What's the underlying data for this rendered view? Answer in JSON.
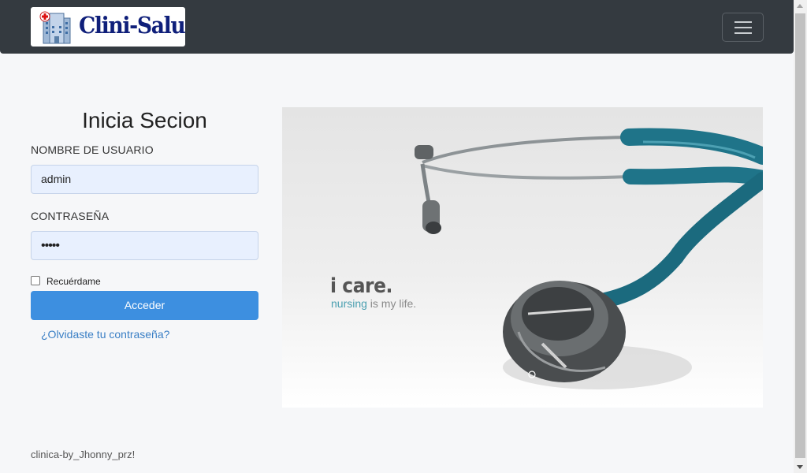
{
  "brand": {
    "name": "Clini-Salud",
    "logo_icon": "hospital-building-icon"
  },
  "navbar": {
    "toggler_icon": "hamburger-menu-icon"
  },
  "login": {
    "title": "Inicia Secion",
    "username_label": "NOMBRE DE USUARIO",
    "username_value": "admin",
    "password_label": "CONTRASEÑA",
    "password_value": "•••••",
    "remember_label": "Recuérdame",
    "submit_label": "Acceder",
    "forgot_link": "¿Olvidaste tu contraseña?"
  },
  "hero": {
    "headline": "i care.",
    "tagline_word": "nursing",
    "tagline_rest": " is my life.",
    "image_subject": "stethoscope-image"
  },
  "footer": {
    "text": "clinica-by_Jhonny_prz!"
  },
  "colors": {
    "navbar": "#343a40",
    "primary_button": "#3d8fe0",
    "link": "#3a7fc5",
    "input_fill": "#e8f0fe",
    "stethoscope_teal": "#1f7489"
  }
}
